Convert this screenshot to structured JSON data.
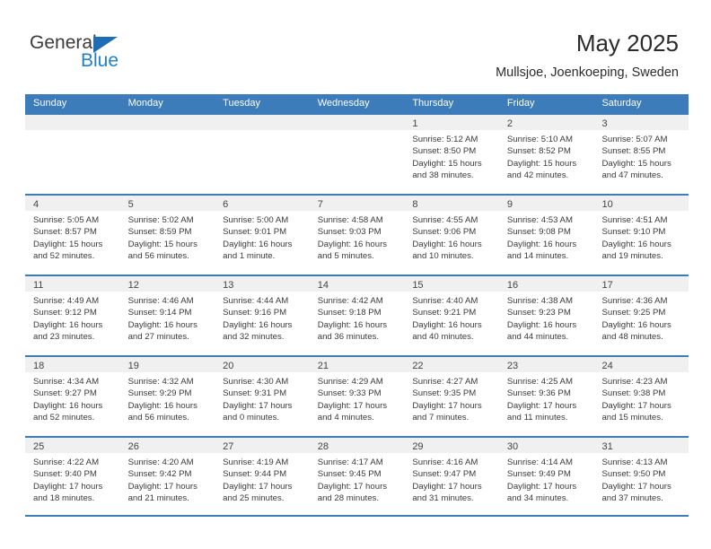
{
  "logo": {
    "word_top": "General",
    "word_bottom": "Blue",
    "triangle_icon": "triangle-icon",
    "brand_blue": "#1f7fd0",
    "brand_dark": "#3b3b3b"
  },
  "header": {
    "title": "May 2025",
    "subtitle": "Mullsjoe, Joenkoeping, Sweden"
  },
  "theme": {
    "header_row_bg": "#3c7cba",
    "day_strip_bg": "#f0f0f0",
    "text": "#3a3a3a"
  },
  "weekdays": [
    "Sunday",
    "Monday",
    "Tuesday",
    "Wednesday",
    "Thursday",
    "Friday",
    "Saturday"
  ],
  "weeks": [
    [
      {
        "day": "",
        "lines": []
      },
      {
        "day": "",
        "lines": []
      },
      {
        "day": "",
        "lines": []
      },
      {
        "day": "",
        "lines": []
      },
      {
        "day": "1",
        "lines": [
          "Sunrise: 5:12 AM",
          "Sunset: 8:50 PM",
          "Daylight: 15 hours",
          "and 38 minutes."
        ]
      },
      {
        "day": "2",
        "lines": [
          "Sunrise: 5:10 AM",
          "Sunset: 8:52 PM",
          "Daylight: 15 hours",
          "and 42 minutes."
        ]
      },
      {
        "day": "3",
        "lines": [
          "Sunrise: 5:07 AM",
          "Sunset: 8:55 PM",
          "Daylight: 15 hours",
          "and 47 minutes."
        ]
      }
    ],
    [
      {
        "day": "4",
        "lines": [
          "Sunrise: 5:05 AM",
          "Sunset: 8:57 PM",
          "Daylight: 15 hours",
          "and 52 minutes."
        ]
      },
      {
        "day": "5",
        "lines": [
          "Sunrise: 5:02 AM",
          "Sunset: 8:59 PM",
          "Daylight: 15 hours",
          "and 56 minutes."
        ]
      },
      {
        "day": "6",
        "lines": [
          "Sunrise: 5:00 AM",
          "Sunset: 9:01 PM",
          "Daylight: 16 hours",
          "and 1 minute."
        ]
      },
      {
        "day": "7",
        "lines": [
          "Sunrise: 4:58 AM",
          "Sunset: 9:03 PM",
          "Daylight: 16 hours",
          "and 5 minutes."
        ]
      },
      {
        "day": "8",
        "lines": [
          "Sunrise: 4:55 AM",
          "Sunset: 9:06 PM",
          "Daylight: 16 hours",
          "and 10 minutes."
        ]
      },
      {
        "day": "9",
        "lines": [
          "Sunrise: 4:53 AM",
          "Sunset: 9:08 PM",
          "Daylight: 16 hours",
          "and 14 minutes."
        ]
      },
      {
        "day": "10",
        "lines": [
          "Sunrise: 4:51 AM",
          "Sunset: 9:10 PM",
          "Daylight: 16 hours",
          "and 19 minutes."
        ]
      }
    ],
    [
      {
        "day": "11",
        "lines": [
          "Sunrise: 4:49 AM",
          "Sunset: 9:12 PM",
          "Daylight: 16 hours",
          "and 23 minutes."
        ]
      },
      {
        "day": "12",
        "lines": [
          "Sunrise: 4:46 AM",
          "Sunset: 9:14 PM",
          "Daylight: 16 hours",
          "and 27 minutes."
        ]
      },
      {
        "day": "13",
        "lines": [
          "Sunrise: 4:44 AM",
          "Sunset: 9:16 PM",
          "Daylight: 16 hours",
          "and 32 minutes."
        ]
      },
      {
        "day": "14",
        "lines": [
          "Sunrise: 4:42 AM",
          "Sunset: 9:18 PM",
          "Daylight: 16 hours",
          "and 36 minutes."
        ]
      },
      {
        "day": "15",
        "lines": [
          "Sunrise: 4:40 AM",
          "Sunset: 9:21 PM",
          "Daylight: 16 hours",
          "and 40 minutes."
        ]
      },
      {
        "day": "16",
        "lines": [
          "Sunrise: 4:38 AM",
          "Sunset: 9:23 PM",
          "Daylight: 16 hours",
          "and 44 minutes."
        ]
      },
      {
        "day": "17",
        "lines": [
          "Sunrise: 4:36 AM",
          "Sunset: 9:25 PM",
          "Daylight: 16 hours",
          "and 48 minutes."
        ]
      }
    ],
    [
      {
        "day": "18",
        "lines": [
          "Sunrise: 4:34 AM",
          "Sunset: 9:27 PM",
          "Daylight: 16 hours",
          "and 52 minutes."
        ]
      },
      {
        "day": "19",
        "lines": [
          "Sunrise: 4:32 AM",
          "Sunset: 9:29 PM",
          "Daylight: 16 hours",
          "and 56 minutes."
        ]
      },
      {
        "day": "20",
        "lines": [
          "Sunrise: 4:30 AM",
          "Sunset: 9:31 PM",
          "Daylight: 17 hours",
          "and 0 minutes."
        ]
      },
      {
        "day": "21",
        "lines": [
          "Sunrise: 4:29 AM",
          "Sunset: 9:33 PM",
          "Daylight: 17 hours",
          "and 4 minutes."
        ]
      },
      {
        "day": "22",
        "lines": [
          "Sunrise: 4:27 AM",
          "Sunset: 9:35 PM",
          "Daylight: 17 hours",
          "and 7 minutes."
        ]
      },
      {
        "day": "23",
        "lines": [
          "Sunrise: 4:25 AM",
          "Sunset: 9:36 PM",
          "Daylight: 17 hours",
          "and 11 minutes."
        ]
      },
      {
        "day": "24",
        "lines": [
          "Sunrise: 4:23 AM",
          "Sunset: 9:38 PM",
          "Daylight: 17 hours",
          "and 15 minutes."
        ]
      }
    ],
    [
      {
        "day": "25",
        "lines": [
          "Sunrise: 4:22 AM",
          "Sunset: 9:40 PM",
          "Daylight: 17 hours",
          "and 18 minutes."
        ]
      },
      {
        "day": "26",
        "lines": [
          "Sunrise: 4:20 AM",
          "Sunset: 9:42 PM",
          "Daylight: 17 hours",
          "and 21 minutes."
        ]
      },
      {
        "day": "27",
        "lines": [
          "Sunrise: 4:19 AM",
          "Sunset: 9:44 PM",
          "Daylight: 17 hours",
          "and 25 minutes."
        ]
      },
      {
        "day": "28",
        "lines": [
          "Sunrise: 4:17 AM",
          "Sunset: 9:45 PM",
          "Daylight: 17 hours",
          "and 28 minutes."
        ]
      },
      {
        "day": "29",
        "lines": [
          "Sunrise: 4:16 AM",
          "Sunset: 9:47 PM",
          "Daylight: 17 hours",
          "and 31 minutes."
        ]
      },
      {
        "day": "30",
        "lines": [
          "Sunrise: 4:14 AM",
          "Sunset: 9:49 PM",
          "Daylight: 17 hours",
          "and 34 minutes."
        ]
      },
      {
        "day": "31",
        "lines": [
          "Sunrise: 4:13 AM",
          "Sunset: 9:50 PM",
          "Daylight: 17 hours",
          "and 37 minutes."
        ]
      }
    ]
  ]
}
